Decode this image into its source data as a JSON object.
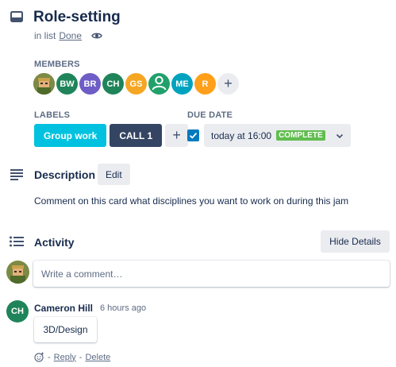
{
  "card": {
    "title": "Role-setting",
    "in_list_prefix": "in list",
    "list_name": "Done"
  },
  "members": {
    "label": "MEMBERS",
    "avatars": [
      {
        "initials": "",
        "color": "#6b7a3c",
        "image": true
      },
      {
        "initials": "BW",
        "color": "#1f845a"
      },
      {
        "initials": "BR",
        "color": "#6e5dc6"
      },
      {
        "initials": "CH",
        "color": "#1f845a"
      },
      {
        "initials": "GS",
        "color": "#f5a623"
      },
      {
        "initials": "",
        "color": "#22a06b",
        "icon": "person-icon"
      },
      {
        "initials": "ME",
        "color": "#00a3bf"
      },
      {
        "initials": "R",
        "color": "#ff9f1a"
      }
    ],
    "add": "+"
  },
  "labels": {
    "label": "LABELS",
    "items": [
      {
        "text": "Group work",
        "color": "#00c2e0"
      },
      {
        "text": "CALL 1",
        "color": "#344563"
      }
    ],
    "add": "+"
  },
  "due_date": {
    "label": "DUE DATE",
    "text": "today at 16:00",
    "status": "COMPLETE",
    "checked": true
  },
  "description": {
    "title": "Description",
    "edit_label": "Edit",
    "text": "Comment on this card what disciplines you want to work on during this jam"
  },
  "activity": {
    "title": "Activity",
    "hide_details_label": "Hide Details",
    "comment_placeholder": "Write a comment…",
    "entries": [
      {
        "initials": "CH",
        "author": "Cameron Hill",
        "time": "6 hours ago",
        "comment": "3D/Design",
        "reply_label": "Reply",
        "delete_label": "Delete",
        "separator": "-"
      }
    ]
  },
  "colors": {
    "text": "#172b4d",
    "subtle": "#5e6c84",
    "button_bg": "#ebecf0",
    "complete": "#61bd4f",
    "checkbox": "#0079bf"
  }
}
